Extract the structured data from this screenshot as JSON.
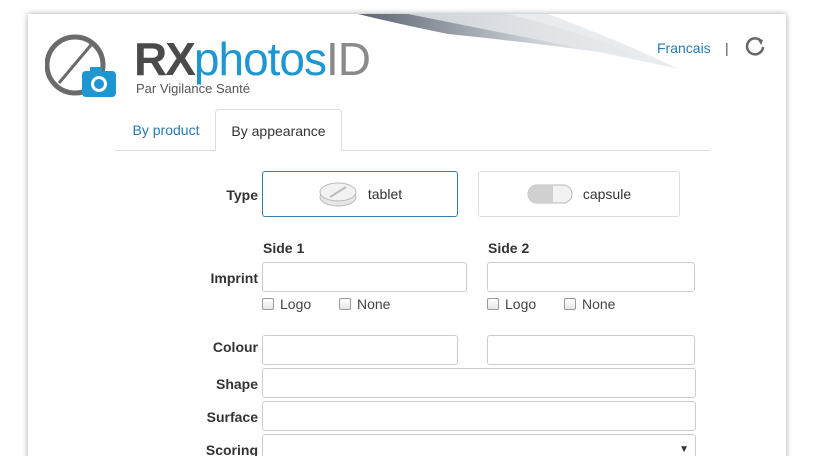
{
  "header": {
    "brand_rx": "RX",
    "brand_photos": "photos",
    "brand_id": "ID",
    "tagline": "Par Vigilance Santé",
    "language_link": "Francais",
    "separator": "|",
    "refresh_icon": "refresh-icon"
  },
  "tabs": [
    {
      "label": "By product",
      "active": false
    },
    {
      "label": "By appearance",
      "active": true
    }
  ],
  "form": {
    "type_label": "Type",
    "type_options": [
      {
        "label": "tablet",
        "selected": true,
        "icon": "tablet-icon"
      },
      {
        "label": "capsule",
        "selected": false,
        "icon": "capsule-icon"
      }
    ],
    "side1_label": "Side 1",
    "side2_label": "Side 2",
    "imprint_label": "Imprint",
    "logo_label": "Logo",
    "none_label": "None",
    "colour_label": "Colour",
    "shape_label": "Shape",
    "surface_label": "Surface",
    "scoring_label": "Scoring"
  },
  "colors": {
    "accent": "#1d96d1",
    "link": "#2a7ab0",
    "selected_border": "#3a7ea8"
  }
}
